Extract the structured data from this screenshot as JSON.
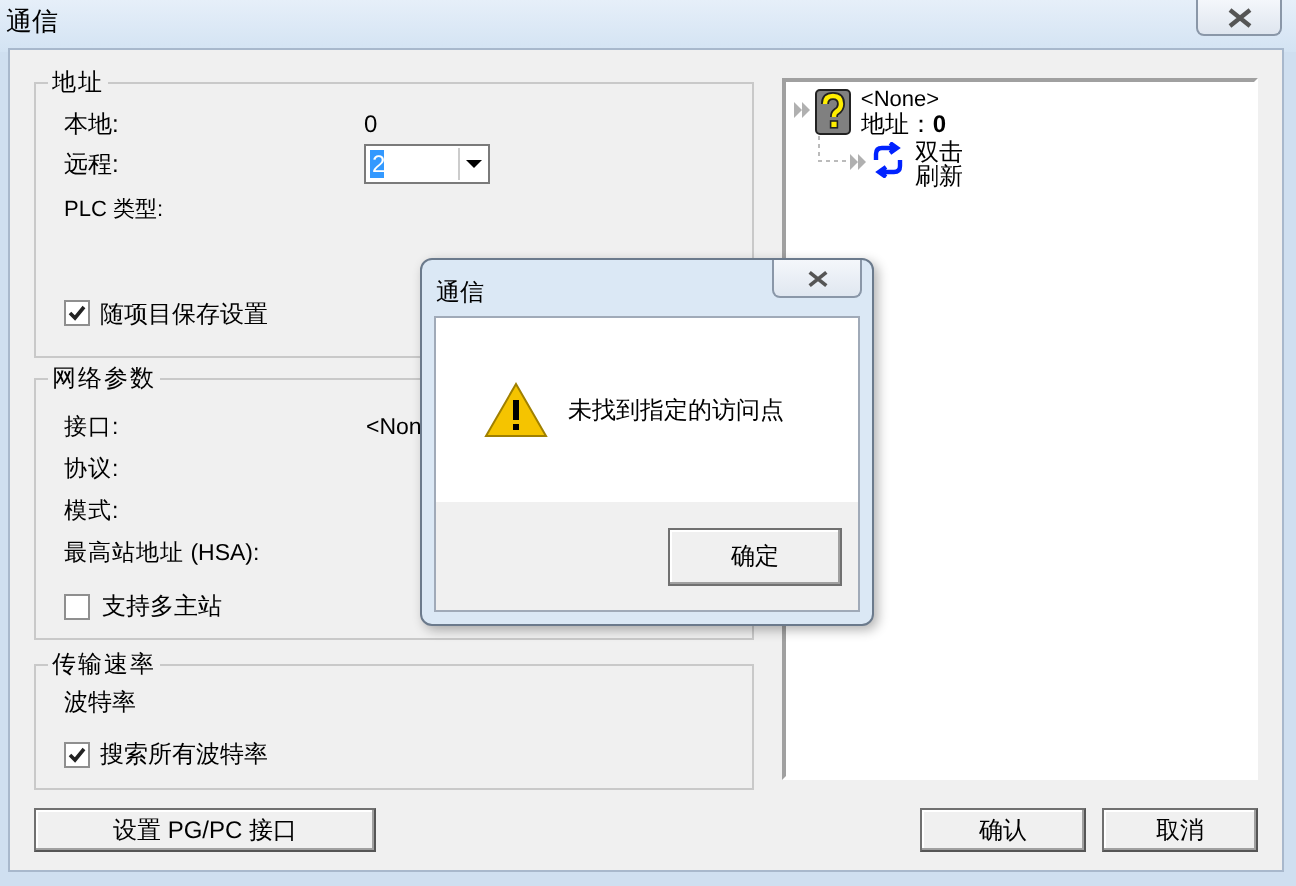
{
  "window": {
    "title": "通信"
  },
  "address_group": {
    "title": "地址",
    "local_label": "本地:",
    "local_value": "0",
    "remote_label": "远程:",
    "remote_value": "2",
    "plc_type_label": "PLC 类型:",
    "save_with_project": {
      "label": "随项目保存设置",
      "checked": true
    }
  },
  "network_group": {
    "title": "网络参数",
    "rows": [
      {
        "label": "接口:",
        "value": "<Non"
      },
      {
        "label": "协议:"
      },
      {
        "label": "模式:"
      },
      {
        "label": "最高站地址 (HSA):"
      }
    ],
    "multi_master": {
      "label": "支持多主站",
      "checked": false
    }
  },
  "baud_group": {
    "title": "传输速率",
    "baud_label": "波特率",
    "search_all": {
      "label": "搜索所有波特率",
      "checked": true
    }
  },
  "tree": {
    "name": "<None>",
    "address": "地址：**0**",
    "children": [
      {
        "label": "双击刷新"
      }
    ]
  },
  "buttons": [
    "设置 PG/PC 接口",
    "确认",
    "取消"
  ],
  "message_box": {
    "title": "通信",
    "message": "未找到指定的访问点",
    "button": "确定"
  }
}
